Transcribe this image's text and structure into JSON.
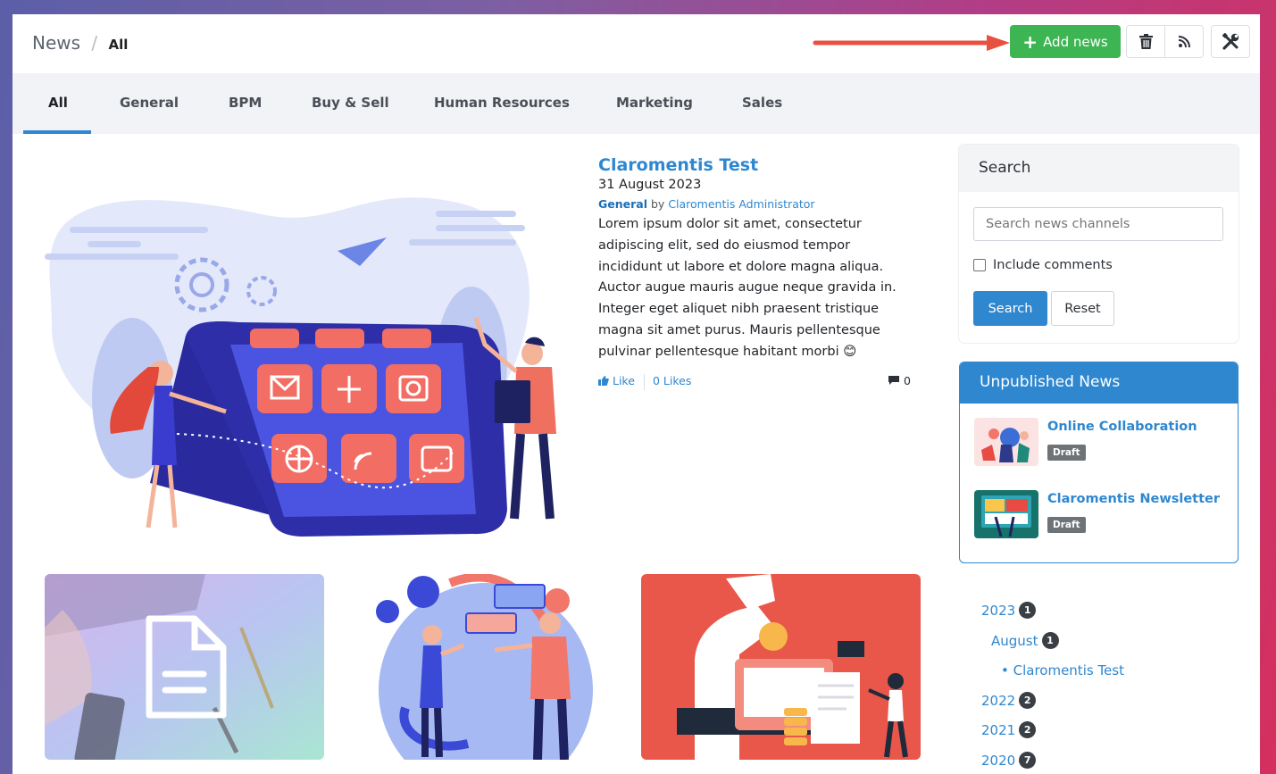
{
  "breadcrumb": {
    "root": "News",
    "separator": "/",
    "current": "All"
  },
  "toolbar": {
    "add_label": "Add news",
    "add_icon": "plus-icon",
    "delete_icon": "trash-icon",
    "rss_icon": "rss-icon",
    "tools_icon": "tools-icon"
  },
  "tabs": [
    "All",
    "General",
    "BPM",
    "Buy & Sell",
    "Human Resources",
    "Marketing",
    "Sales"
  ],
  "featured": {
    "title": "Claromentis Test",
    "date": "31 August 2023",
    "category": "General",
    "by": "by",
    "author": "Claromentis Administrator",
    "body": "Lorem ipsum dolor sit amet, consectetur adipiscing elit, sed do eiusmod tempor incididunt ut labore et dolore magna aliqua. Auctor augue mauris augue neque gravida in. Integer eget aliquet nibh praesent tristique magna sit amet purus. Mauris pellentesque pulvinar pellentesque habitant morbi",
    "emoji": "😊",
    "like_label": "Like",
    "likes_label": "0 Likes",
    "comment_count": "0"
  },
  "search": {
    "heading": "Search",
    "placeholder": "Search news channels",
    "include_comments_label": "Include comments",
    "search_button": "Search",
    "reset_button": "Reset"
  },
  "unpublished": {
    "heading": "Unpublished News",
    "items": [
      {
        "title": "Online Collaboration",
        "status": "Draft"
      },
      {
        "title": "Claromentis Newsletter",
        "status": "Draft"
      }
    ]
  },
  "archive": [
    {
      "label": "2023",
      "count": "1"
    },
    {
      "label": "August",
      "count": "1"
    },
    {
      "label": "• Claromentis Test"
    },
    {
      "label": "2022",
      "count": "2"
    },
    {
      "label": "2021",
      "count": "2"
    },
    {
      "label": "2020",
      "count": "7"
    }
  ],
  "colors": {
    "primary": "#2f87cf",
    "success": "#3db553",
    "arrow": "#e8503f"
  }
}
